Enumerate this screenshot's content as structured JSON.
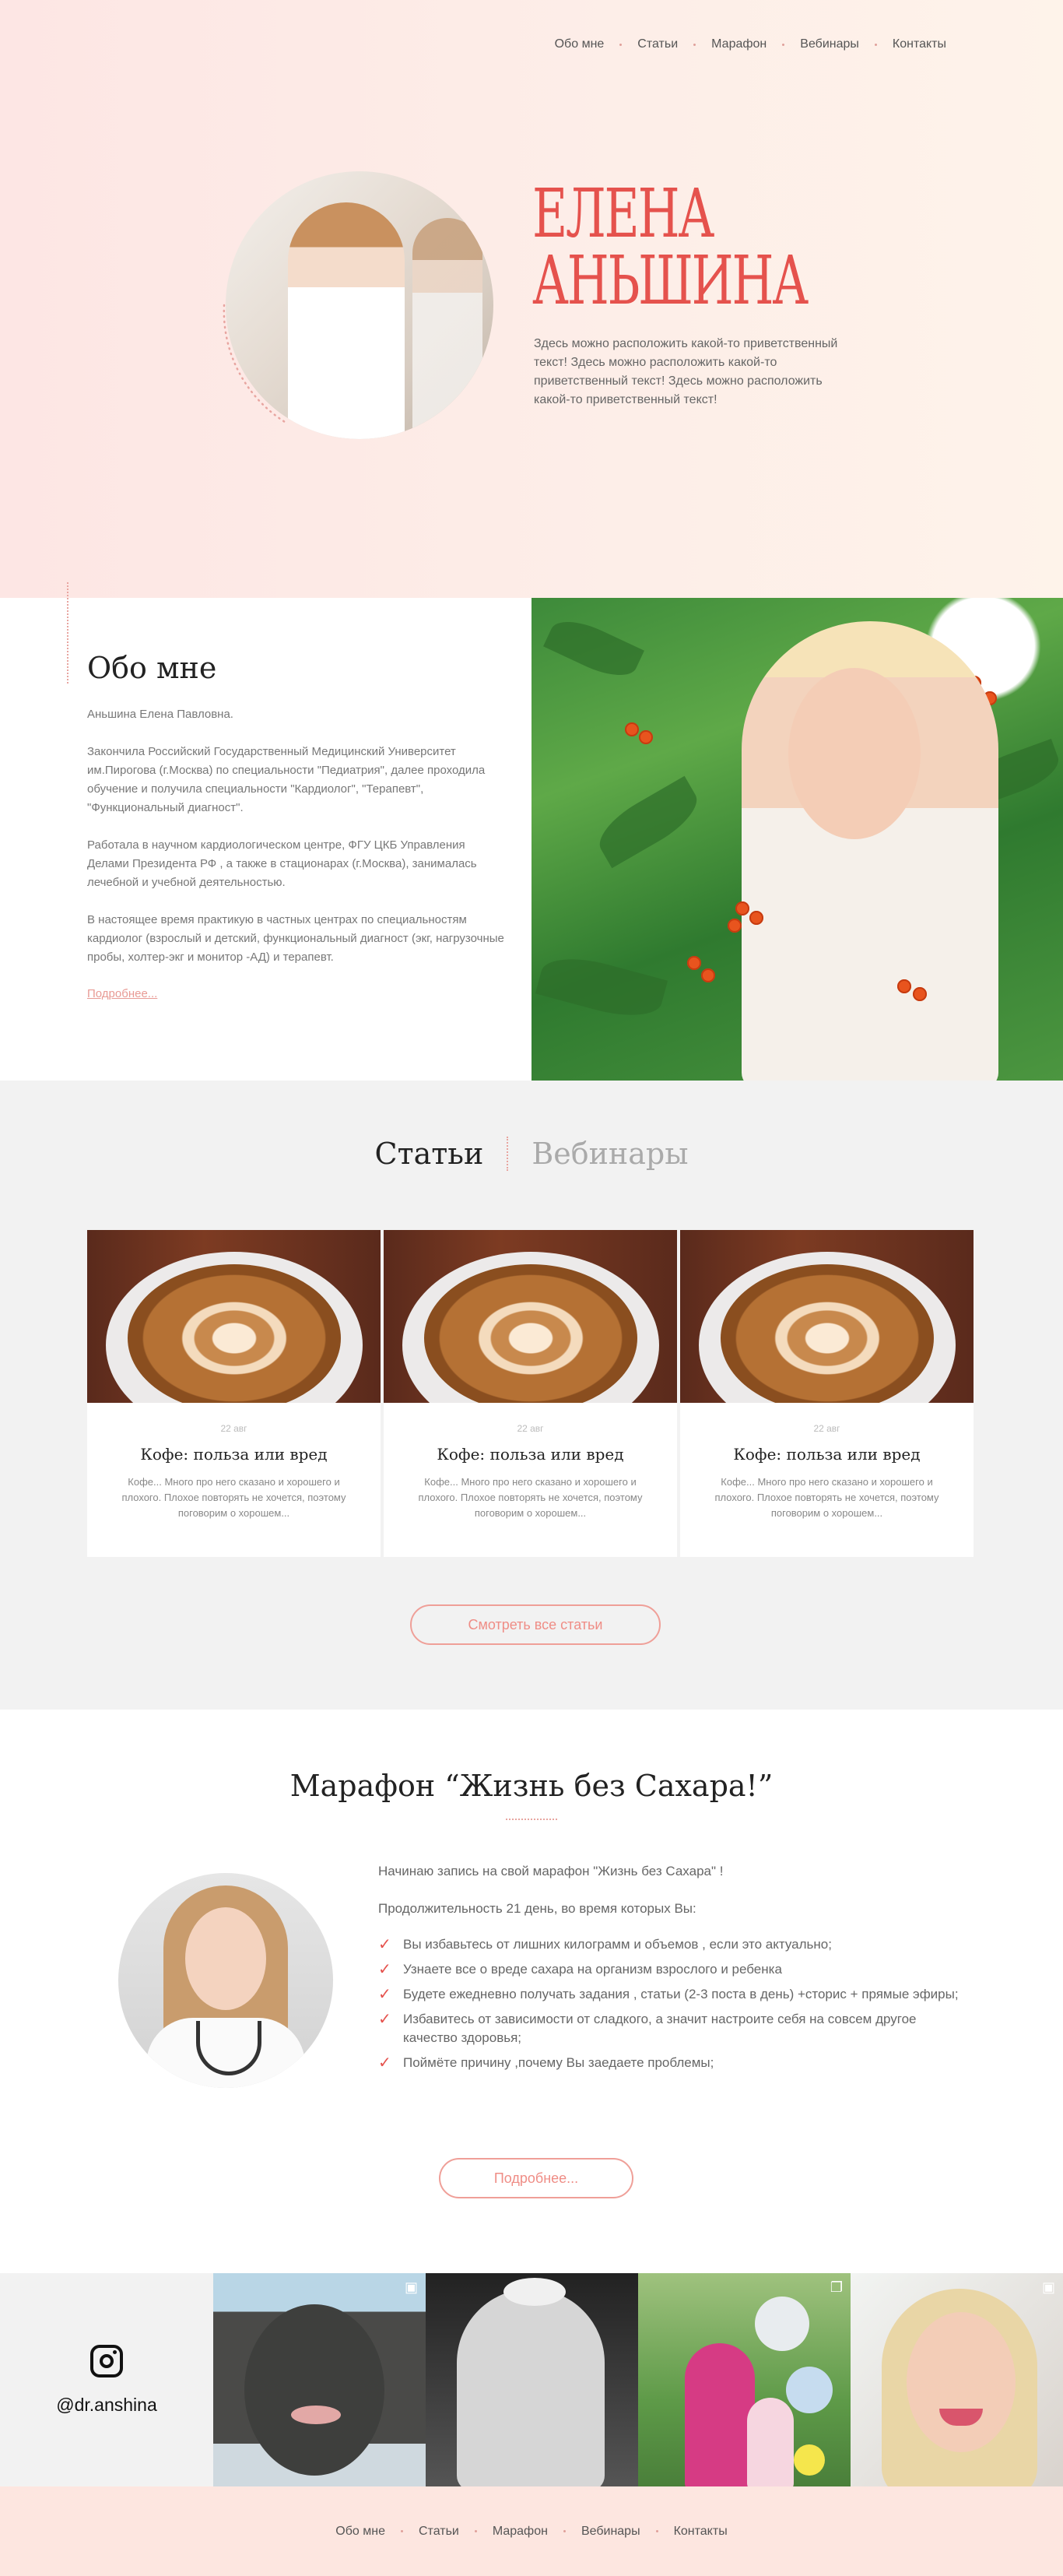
{
  "nav": {
    "items": [
      "Обо мне",
      "Статьи",
      "Марафон",
      "Вебинары",
      "Контакты"
    ]
  },
  "hero": {
    "name_line1": "ЕЛЕНА",
    "name_line2": "АНЬШИНА",
    "text": "Здесь можно расположить какой-то приветственный текст! Здесь можно расположить какой-то приветственный текст! Здесь можно расположить какой-то приветственный текст!"
  },
  "about": {
    "title": "Обо мне",
    "paragraphs": [
      "Аньшина Елена Павловна.",
      "Закончила Российский Государственный Медицинский Университет им.Пирогова (г.Москва) по специальности \"Педиатрия\", далее проходила обучение и получила специальности \"Кардиолог\", \"Терапевт\", \"Функциональный диагност\".",
      "Работала в научном кардиологическом центре, ФГУ ЦКБ Управления Делами Президента РФ , а также в стационарах (г.Москва), занималась лечебной и учебной деятельностью.",
      "В настоящее время практикую в частных центрах по специальностям кардиолог (взрослый и детский, функциональный диагност (экг, нагрузочные пробы, холтер-экг и монитор -АД) и терапевт."
    ],
    "more_link": "Подробнее..."
  },
  "articles": {
    "tab_active": "Статьи",
    "tab_inactive": "Вебинары",
    "cards": [
      {
        "date": "22 авг",
        "title": "Кофе: польза или вред",
        "desc": "Кофе... Много про него сказано и хорошего и плохого. Плохое повторять не хочется, поэтому поговорим о хорошем..."
      },
      {
        "date": "22 авг",
        "title": "Кофе: польза или вред",
        "desc": "Кофе... Много про него сказано и хорошего и плохого. Плохое повторять не хочется, поэтому поговорим о хорошем..."
      },
      {
        "date": "22 авг",
        "title": "Кофе: польза или вред",
        "desc": "Кофе... Много про него сказано и хорошего и плохого. Плохое повторять не хочется, поэтому поговорим о хорошем..."
      }
    ],
    "button": "Смотреть все статьи"
  },
  "marathon": {
    "title": "Марафон “Жизнь без Сахара!”",
    "intro": "Начинаю запись на свой марафон \"Жизнь без Сахара\" !",
    "duration": "Продолжительность 21 день, во время которых Вы:",
    "list": [
      "Вы избавьтесь от лишних килограмм и объемов , если это актуально;",
      "Узнаете все о вреде сахара на организм взрослого и ребенка",
      "Будете ежедневно получать задания , статьи (2-3 поста в день) +сторис + прямые эфиры;",
      "Избавитесь от зависимости от сладкого, а значит настроите себя на совсем другое качество здоровья;",
      "Поймёте причину ,почему Вы заедаете проблемы;"
    ],
    "button": "Подробнее..."
  },
  "instagram": {
    "handle": "@dr.anshina"
  },
  "colors": {
    "accent": "#e5524d",
    "accent_light": "#ef9f98",
    "hero_bg": "#fde6e4",
    "section_gray": "#f2f2f2",
    "footer_bg": "#fde6e0"
  }
}
